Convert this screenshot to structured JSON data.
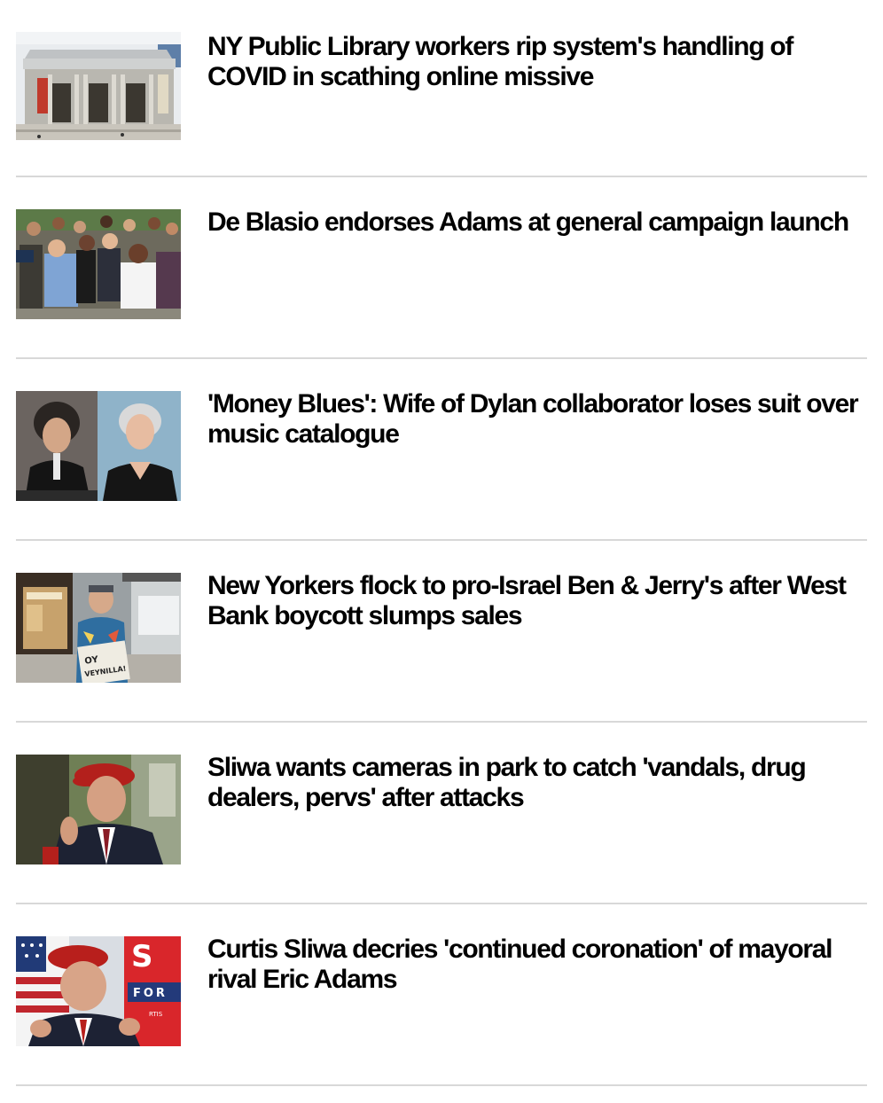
{
  "feed": {
    "stories": [
      {
        "headline": "NY Public Library workers rip system's handling of COVID in scathing online missive",
        "image": "library-photo"
      },
      {
        "headline": "De Blasio endorses Adams at general campaign launch",
        "image": "campaign-crowd-photo"
      },
      {
        "headline": "'Money Blues': Wife of Dylan collaborator loses suit over music catalogue",
        "image": "portraits-photo"
      },
      {
        "headline": "New Yorkers flock to pro-Israel Ben & Jerry's after West Bank boycott slumps sales",
        "image": "shopper-newspaper-photo"
      },
      {
        "headline": "Sliwa wants cameras in park to catch 'vandals, drug dealers, pervs' after attacks",
        "image": "red-beret-man-photo"
      },
      {
        "headline": "Curtis Sliwa decries 'continued coronation' of mayoral rival Eric Adams",
        "image": "red-beret-flag-photo"
      }
    ],
    "thumb_banner": {
      "letters": "S",
      "for_text": "FOR",
      "small_text": "RTIS"
    },
    "newspaper_text": {
      "line1": "OY",
      "line2": "VEYNILLA!"
    }
  }
}
